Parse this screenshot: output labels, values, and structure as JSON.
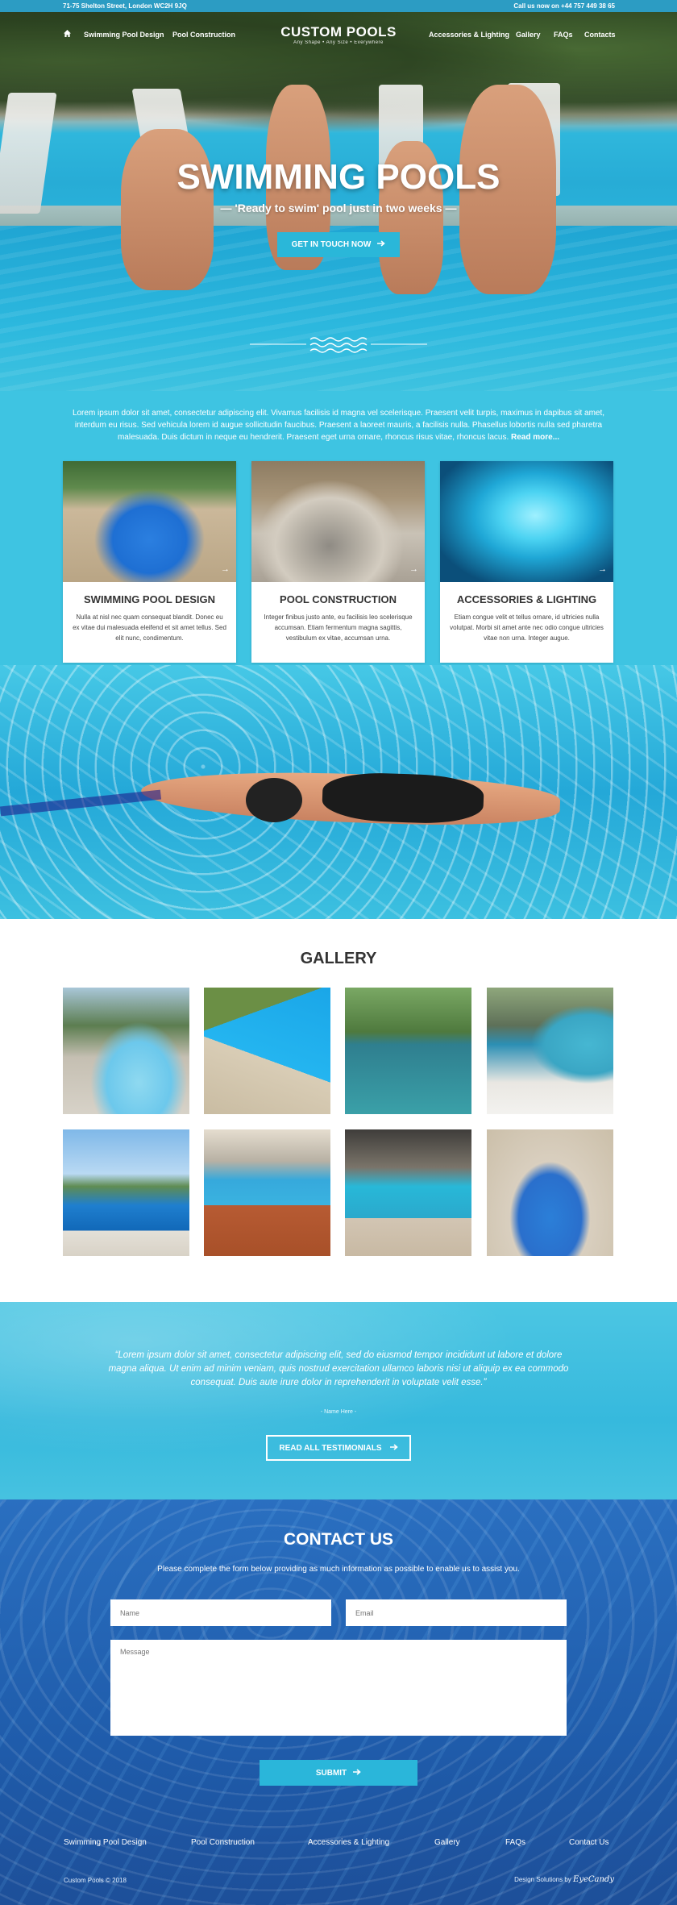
{
  "topbar": {
    "address": "71-75 Shelton Street, London WC2H 9JQ",
    "phone": "Call us now on +44 757 449 38 65"
  },
  "nav": {
    "left": [
      "Swimming Pool Design",
      "Pool Construction"
    ],
    "logo_title": "CUSTOM POOLS",
    "logo_tagline": "Any Shape  •  Any Size  •  Everywhere",
    "right": [
      "Accessories & Lighting",
      "Gallery",
      "FAQs",
      "Contacts"
    ],
    "home_icon": "home-icon"
  },
  "hero": {
    "title": "SWIMMING POOLS",
    "subtitle": "— 'Ready to swim' pool just in two weeks —",
    "button": "GET IN TOUCH NOW"
  },
  "intro": {
    "text": "Lorem ipsum dolor sit amet, consectetur adipiscing elit. Vivamus facilisis id magna vel scelerisque. Praesent velit turpis, maximus in dapibus sit amet, interdum eu risus. Sed vehicula lorem id augue sollicitudin faucibus. Praesent a laoreet mauris, a facilisis nulla. Phasellus lobortis nulla sed pharetra malesuada. Duis dictum in neque eu hendrerit. Praesent eget urna ornare, rhoncus risus vitae, rhoncus lacus.",
    "more": "Read more..."
  },
  "services": [
    {
      "title": "SWIMMING POOL DESIGN",
      "text": "Nulla at nisl nec quam consequat blandit. Donec eu ex vitae dui malesuada eleifend et sit amet tellus. Sed elit nunc, condimentum."
    },
    {
      "title": "POOL CONSTRUCTION",
      "text": "Integer finibus justo ante, eu facilisis leo scelerisque accumsan. Etiam fermentum magna sagittis, vestibulum ex vitae, accumsan urna."
    },
    {
      "title": "ACCESSORIES & LIGHTING",
      "text": "Etiam congue velit et tellus ornare, id ultricies nulla volutpat. Morbi sit amet ante nec odio congue ultricies vitae non urna. Integer augue."
    }
  ],
  "gallery": {
    "title": "GALLERY"
  },
  "testimonial": {
    "quote": "“Lorem ipsum dolor sit amet, consectetur adipiscing elit, sed do eiusmod tempor incididunt ut labore et dolore magna aliqua. Ut enim ad minim veniam, quis nostrud exercitation ullamco laboris nisi ut aliquip ex ea commodo consequat. Duis aute irure dolor in reprehenderit in voluptate velit esse.”",
    "name": "- Name Here -",
    "button": "READ ALL TESTIMONIALS"
  },
  "contact": {
    "title": "CONTACT US",
    "subtitle": "Please complete the form below providing as much information as possible to enable us to assist you.",
    "name_placeholder": "Name",
    "email_placeholder": "Email",
    "message_placeholder": "Message",
    "submit": "SUBMIT"
  },
  "footer": {
    "links": [
      "Swimming Pool Design",
      "Pool Construction",
      "Accessories & Lighting",
      "Gallery",
      "FAQs",
      "Contact Us"
    ],
    "copyright": "Custom Pools © 2018",
    "credit_label": "Design Solutions by",
    "credit_brand": "EyeCandy"
  },
  "colors": {
    "accent": "#2ab7d9",
    "topbar": "#2c9cc3",
    "intro_bg": "#3ec4e2",
    "contact_bg": "#2a6fc0"
  }
}
